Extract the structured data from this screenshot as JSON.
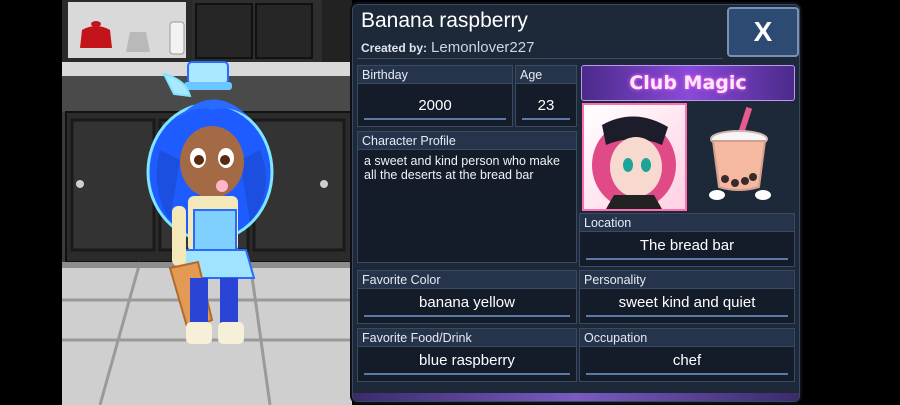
{
  "character": {
    "name": "Banana raspberry",
    "created_by_label": "Created by:",
    "created_by": "Lemonlover227"
  },
  "close_label": "X",
  "fields": {
    "birthday": {
      "label": "Birthday",
      "value": "2000"
    },
    "age": {
      "label": "Age",
      "value": "23"
    },
    "profile": {
      "label": "Character Profile",
      "value": "a sweet and kind person who make all the deserts at the bread bar"
    },
    "location": {
      "label": "Location",
      "value": "The bread bar"
    },
    "favorite_color": {
      "label": "Favorite Color",
      "value": "banana yellow"
    },
    "personality": {
      "label": "Personality",
      "value": "sweet kind and quiet"
    },
    "favorite_food": {
      "label": "Favorite Food/Drink",
      "value": "blue raspberry"
    },
    "occupation": {
      "label": "Occupation",
      "value": "chef"
    }
  },
  "club": {
    "name": "Club Magic"
  },
  "colors": {
    "panel": "#1d2838",
    "accent": "#5c79a8",
    "close": "#2d4a72"
  }
}
